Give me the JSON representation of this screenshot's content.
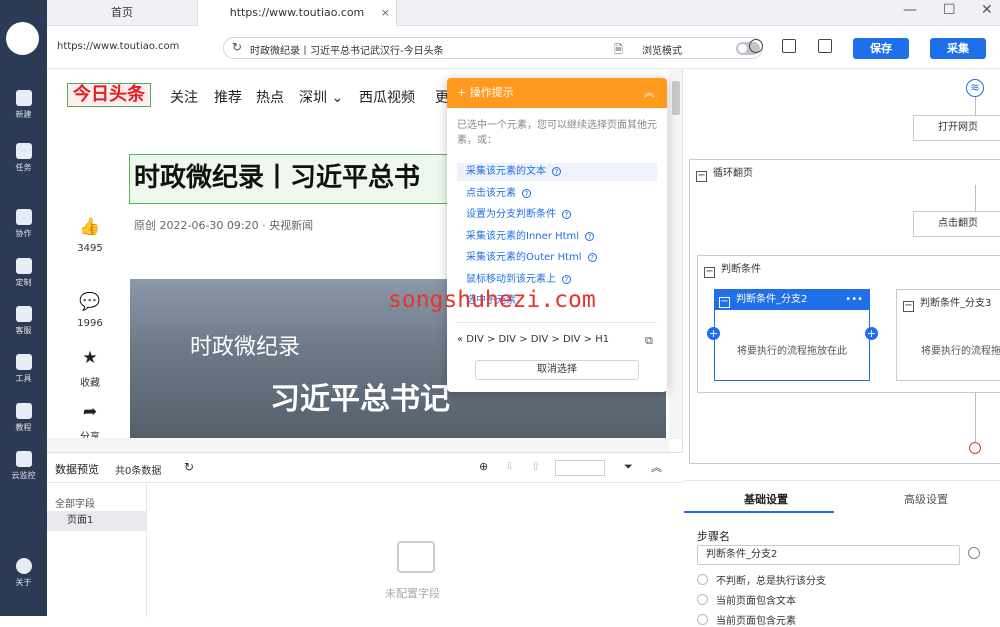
{
  "tabs": {
    "tab1": "首页",
    "tab2": "https://www.toutiao.com",
    "close": "×"
  },
  "window": {
    "min": "—",
    "max": "☐",
    "close": "✕"
  },
  "urlbar": {
    "url_left": "https://www.toutiao.com",
    "address": "时政微纪录丨习近平总书记武汉行-今日头条",
    "browse_mode": "浏览模式",
    "save": "保存",
    "collect": "采集"
  },
  "sidebar": [
    {
      "label": "新建",
      "icon": "plus-icon"
    },
    {
      "label": "任务",
      "icon": "bookmark-icon"
    },
    {
      "label": "协作",
      "icon": "users-icon"
    },
    {
      "label": "定制",
      "icon": "heart-icon"
    },
    {
      "label": "客服",
      "icon": "headset-icon"
    },
    {
      "label": "工具",
      "icon": "toolbox-icon"
    },
    {
      "label": "教程",
      "icon": "graduation-icon"
    },
    {
      "label": "云监控",
      "icon": "cloud-icon"
    },
    {
      "label": "关于",
      "icon": "info-icon"
    }
  ],
  "webpage": {
    "logo": "今日头条",
    "nav": [
      "关注",
      "推荐",
      "热点",
      "深圳 ⌄",
      "西瓜视频",
      "更"
    ],
    "headline": "时政微纪录丨习近平总书",
    "meta": "原创   2022-06-30 09:20 · 央视新闻",
    "actions": [
      {
        "glyph": "👍",
        "label": "3495"
      },
      {
        "glyph": "💬",
        "label": "1996"
      },
      {
        "glyph": "★",
        "label": "收藏"
      },
      {
        "glyph": "➦",
        "label": "分享"
      }
    ],
    "hero_text1": "时政微纪录",
    "hero_text2": "习近平总书记"
  },
  "popup": {
    "title": "+ 操作提示",
    "desc": "已选中一个元素，您可以继续选择页面其他元素，或：",
    "items": [
      "采集该元素的文本",
      "点击该元素",
      "设置为分支判断条件",
      "采集该元素的Inner Html",
      "采集该元素的Outer Html",
      "鼠标移动到该元素上",
      "选中子元素"
    ],
    "path": "«  DIV  >  DIV  >  DIV  >  DIV  >  H1",
    "cancel": "取消选择"
  },
  "watermark": "songshuhezi.com",
  "preview": {
    "title": "数据预览",
    "count": "共0条数据",
    "all_fields": "全部字段",
    "page1": "页面1",
    "empty": "未配置字段"
  },
  "flow": {
    "open_page": "打开网页",
    "loop": "循环翻页",
    "click_next": "点击翻页",
    "condition": "判断条件",
    "branch1": "判断条件_分支2",
    "branch2": "判断条件_分支3",
    "drop_hint": "将要执行的流程拖放在此"
  },
  "settings": {
    "tab_basic": "基础设置",
    "tab_advanced": "高级设置",
    "step_name_label": "步骤名",
    "step_name_value": "判断条件_分支2",
    "options": [
      "不判断，总是执行该分支",
      "当前页面包含文本",
      "当前页面包含元素"
    ]
  },
  "colors": {
    "accent": "#1e6fe8",
    "popup_header": "#ff9a1f",
    "sidebar": "#2b3a55",
    "watermark": "#e8342a"
  }
}
